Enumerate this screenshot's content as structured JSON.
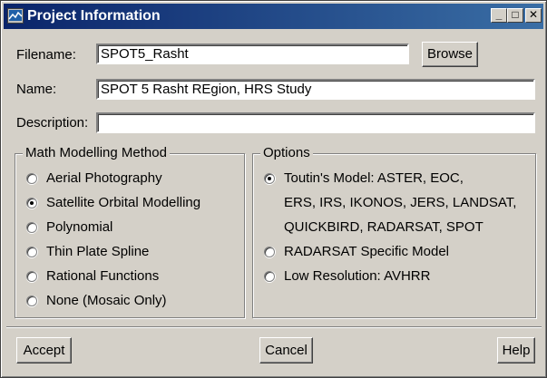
{
  "window": {
    "title": "Project Information"
  },
  "caption_buttons": {
    "minimize": "_",
    "maximize": "□",
    "close": "✕"
  },
  "filename": {
    "label": "Filename:",
    "value": "SPOT5_Rasht"
  },
  "browse_label": "Browse",
  "name": {
    "label": "Name:",
    "value": "SPOT 5 Rasht REgion, HRS Study"
  },
  "description": {
    "label": "Description:",
    "value": ""
  },
  "math_modelling": {
    "title": "Math Modelling Method",
    "selected": "Satellite Orbital Modelling",
    "options": [
      "Aerial Photography",
      "Satellite Orbital Modelling",
      "Polynomial",
      "Thin Plate Spline",
      "Rational Functions",
      "None (Mosaic Only)"
    ]
  },
  "options_group": {
    "title": "Options",
    "selected": "Toutin's Model",
    "toutin_lines": [
      "Toutin's Model: ASTER, EOC,",
      "ERS, IRS, IKONOS, JERS, LANDSAT,",
      "QUICKBIRD, RADARSAT, SPOT"
    ],
    "radarsat": "RADARSAT Specific Model",
    "low_res": "Low Resolution: AVHRR"
  },
  "footer": {
    "accept": "Accept",
    "cancel": "Cancel",
    "help": "Help"
  }
}
